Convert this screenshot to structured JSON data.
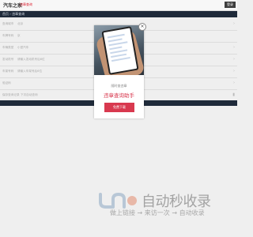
{
  "header": {
    "logo": "汽车之家",
    "logo_sub": "违章查询",
    "login_label": "登录"
  },
  "nav": {
    "breadcrumb": "首页 › 违章查询"
  },
  "form": {
    "rows": [
      {
        "label": "查询城市",
        "value": "北京"
      },
      {
        "label": "车牌号码",
        "value": "京"
      },
      {
        "label": "车辆类型",
        "value": "小型汽车"
      },
      {
        "label": "发动机号",
        "value": "请输入发动机号后6位"
      },
      {
        "label": "车架号码",
        "value": "请输入车架号后6位"
      },
      {
        "label": "验证码",
        "value": ""
      },
      {
        "label": "保存查询记录",
        "value": "下次自动查询"
      }
    ]
  },
  "popup": {
    "subtitle": "随时查违章",
    "title": "违章查询助手",
    "download_label": "免费下载"
  },
  "watermark": {
    "text": "自动秒收录",
    "tagline": "做上链接 → 来访一次 → 自动收录"
  }
}
